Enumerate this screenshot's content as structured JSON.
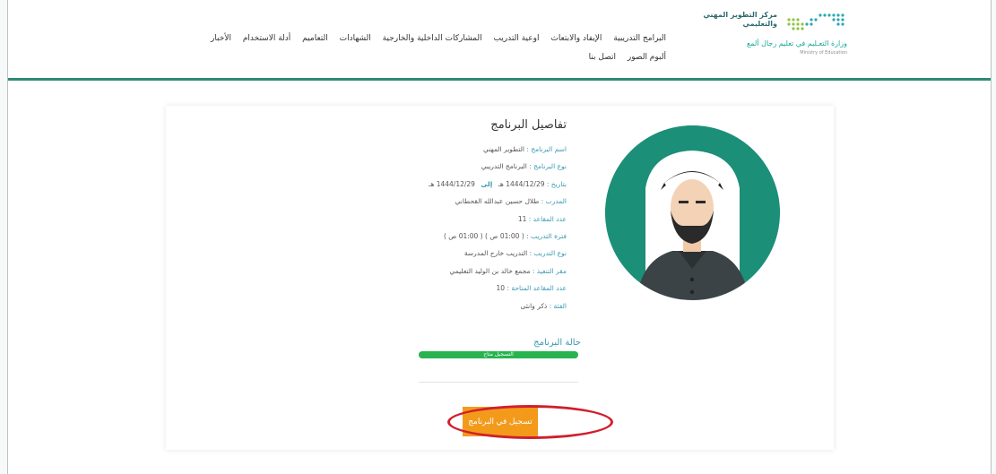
{
  "header": {
    "logo": {
      "center_title": "مركز التطوير المهني والتعليمي",
      "ministry": "وزارة التعـليم في تعليم رجال ألمع",
      "ministry_en": "Ministry of Education"
    },
    "nav_row1": [
      {
        "label": "البرامج التدريبية"
      },
      {
        "label": "الإيفاد والابتعاث"
      },
      {
        "label": "اوعية التدريب"
      },
      {
        "label": "المشاركات الداخلية والخارجية"
      },
      {
        "label": "الشهادات"
      },
      {
        "label": "التعاميم"
      },
      {
        "label": "أدلة الاستخدام"
      },
      {
        "label": "الأخبار"
      }
    ],
    "nav_row2": [
      {
        "label": "ألبوم الصور"
      },
      {
        "label": "اتصل بنا"
      }
    ]
  },
  "program": {
    "title": "تفاصيل البرنامج",
    "lines": [
      {
        "label": "اسم البرنامج :",
        "value": "التطوير المهني"
      },
      {
        "label": "نوع البرنامج :",
        "value": "البرنامج التدريبي"
      },
      {
        "label": "بتاريخ :",
        "value": "1444/12/29 هـ",
        "to": "إلى",
        "value2": "1444/12/29 هـ"
      },
      {
        "label": "المدرب :",
        "value": "طلال حسين عبدالله القحطاني"
      },
      {
        "label": "عدد المقاعد :",
        "value": "11"
      },
      {
        "label": "فترة التدريب :",
        "value": "( 01:00 ص ) ( 01:00 ص )"
      },
      {
        "label": "نوع التدريب :",
        "value": "التدريب خارج المدرسة"
      },
      {
        "label": "مقر التنفيذ :",
        "value": "مجمع خالد بن الوليد التعليمي"
      },
      {
        "label": "عدد المقاعد المتاحة :",
        "value": "10"
      },
      {
        "label": "الفئة :",
        "value": "ذكر وانثى"
      }
    ],
    "status_label": "حالة البرنامج",
    "status_text": "التسجيل متاح",
    "status_progress": 1.0,
    "register_button": "تسجيل في البرنامج"
  },
  "colors": {
    "accent": "#2f8a78",
    "register": "#f39a1b",
    "status": "#27b34f",
    "highlight": "#d01f2c",
    "label_blue": "#3a9ab2"
  }
}
